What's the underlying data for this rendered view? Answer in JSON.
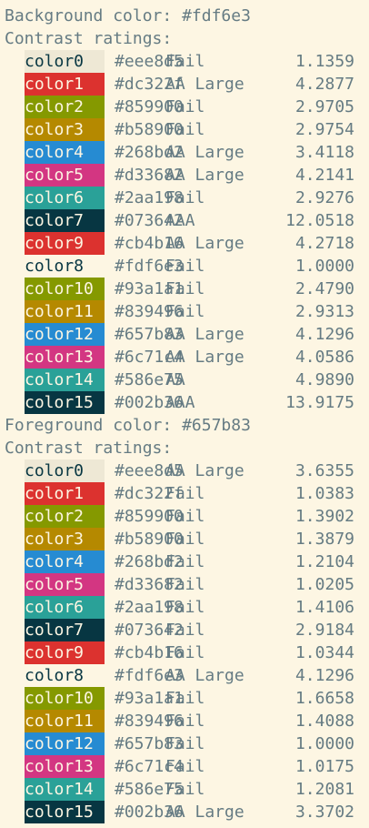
{
  "sections": [
    {
      "title": "Background color: #fdf6e3",
      "ratings_label": "Contrast ratings:",
      "rows": [
        {
          "name": "color0",
          "bg": "#eee8d5",
          "fg": "#073642",
          "hex": "#eee8d5",
          "rating": "Fail",
          "ratio": "1.1359"
        },
        {
          "name": "color1",
          "bg": "#dc322f",
          "fg": "#fdf6e3",
          "hex": "#dc322f",
          "rating": "AA Large",
          "ratio": "4.2877"
        },
        {
          "name": "color2",
          "bg": "#859900",
          "fg": "#fdf6e3",
          "hex": "#859900",
          "rating": "Fail",
          "ratio": "2.9705"
        },
        {
          "name": "color3",
          "bg": "#b58900",
          "fg": "#fdf6e3",
          "hex": "#b58900",
          "rating": "Fail",
          "ratio": "2.9754"
        },
        {
          "name": "color4",
          "bg": "#268bd2",
          "fg": "#fdf6e3",
          "hex": "#268bd2",
          "rating": "AA Large",
          "ratio": "3.4118"
        },
        {
          "name": "color5",
          "bg": "#d33682",
          "fg": "#fdf6e3",
          "hex": "#d33682",
          "rating": "AA Large",
          "ratio": "4.2141"
        },
        {
          "name": "color6",
          "bg": "#2aa198",
          "fg": "#fdf6e3",
          "hex": "#2aa198",
          "rating": "Fail",
          "ratio": "2.9276"
        },
        {
          "name": "color7",
          "bg": "#073642",
          "fg": "#fdf6e3",
          "hex": "#073642",
          "rating": "AAA",
          "ratio": "12.0518"
        },
        {
          "name": "color9",
          "bg": "#dc322f",
          "fg": "#fdf6e3",
          "hex": "#cb4b16",
          "rating": "AA Large",
          "ratio": "4.2718"
        },
        {
          "name": "color8",
          "bg": "#fdf6e3",
          "fg": "#073642",
          "hex": "#fdf6e3",
          "rating": "Fail",
          "ratio": "1.0000"
        },
        {
          "name": "color10",
          "bg": "#859900",
          "fg": "#fdf6e3",
          "hex": "#93a1a1",
          "rating": "Fail",
          "ratio": "2.4790"
        },
        {
          "name": "color11",
          "bg": "#b58900",
          "fg": "#fdf6e3",
          "hex": "#839496",
          "rating": "Fail",
          "ratio": "2.9313"
        },
        {
          "name": "color12",
          "bg": "#268bd2",
          "fg": "#fdf6e3",
          "hex": "#657b83",
          "rating": "AA Large",
          "ratio": "4.1296"
        },
        {
          "name": "color13",
          "bg": "#d33682",
          "fg": "#fdf6e3",
          "hex": "#6c71c4",
          "rating": "AA Large",
          "ratio": "4.0586"
        },
        {
          "name": "color14",
          "bg": "#2aa198",
          "fg": "#fdf6e3",
          "hex": "#586e75",
          "rating": "AA",
          "ratio": "4.9890"
        },
        {
          "name": "color15",
          "bg": "#073642",
          "fg": "#fdf6e3",
          "hex": "#002b36",
          "rating": "AAA",
          "ratio": "13.9175"
        }
      ]
    },
    {
      "title": "Foreground color: #657b83",
      "ratings_label": "Contrast ratings:",
      "rows": [
        {
          "name": "color0",
          "bg": "#eee8d5",
          "fg": "#073642",
          "hex": "#eee8d5",
          "rating": "AA Large",
          "ratio": "3.6355"
        },
        {
          "name": "color1",
          "bg": "#dc322f",
          "fg": "#fdf6e3",
          "hex": "#dc322f",
          "rating": "Fail",
          "ratio": "1.0383"
        },
        {
          "name": "color2",
          "bg": "#859900",
          "fg": "#fdf6e3",
          "hex": "#859900",
          "rating": "Fail",
          "ratio": "1.3902"
        },
        {
          "name": "color3",
          "bg": "#b58900",
          "fg": "#fdf6e3",
          "hex": "#b58900",
          "rating": "Fail",
          "ratio": "1.3879"
        },
        {
          "name": "color4",
          "bg": "#268bd2",
          "fg": "#fdf6e3",
          "hex": "#268bd2",
          "rating": "Fail",
          "ratio": "1.2104"
        },
        {
          "name": "color5",
          "bg": "#d33682",
          "fg": "#fdf6e3",
          "hex": "#d33682",
          "rating": "Fail",
          "ratio": "1.0205"
        },
        {
          "name": "color6",
          "bg": "#2aa198",
          "fg": "#fdf6e3",
          "hex": "#2aa198",
          "rating": "Fail",
          "ratio": "1.4106"
        },
        {
          "name": "color7",
          "bg": "#073642",
          "fg": "#fdf6e3",
          "hex": "#073642",
          "rating": "Fail",
          "ratio": "2.9184"
        },
        {
          "name": "color9",
          "bg": "#dc322f",
          "fg": "#fdf6e3",
          "hex": "#cb4b16",
          "rating": "Fail",
          "ratio": "1.0344"
        },
        {
          "name": "color8",
          "bg": "#fdf6e3",
          "fg": "#073642",
          "hex": "#fdf6e3",
          "rating": "AA Large",
          "ratio": "4.1296"
        },
        {
          "name": "color10",
          "bg": "#859900",
          "fg": "#fdf6e3",
          "hex": "#93a1a1",
          "rating": "Fail",
          "ratio": "1.6658"
        },
        {
          "name": "color11",
          "bg": "#b58900",
          "fg": "#fdf6e3",
          "hex": "#839496",
          "rating": "Fail",
          "ratio": "1.4088"
        },
        {
          "name": "color12",
          "bg": "#268bd2",
          "fg": "#fdf6e3",
          "hex": "#657b83",
          "rating": "Fail",
          "ratio": "1.0000"
        },
        {
          "name": "color13",
          "bg": "#d33682",
          "fg": "#fdf6e3",
          "hex": "#6c71c4",
          "rating": "Fail",
          "ratio": "1.0175"
        },
        {
          "name": "color14",
          "bg": "#2aa198",
          "fg": "#fdf6e3",
          "hex": "#586e75",
          "rating": "Fail",
          "ratio": "1.2081"
        },
        {
          "name": "color15",
          "bg": "#073642",
          "fg": "#fdf6e3",
          "hex": "#002b36",
          "rating": "AA Large",
          "ratio": "3.3702"
        }
      ]
    }
  ]
}
